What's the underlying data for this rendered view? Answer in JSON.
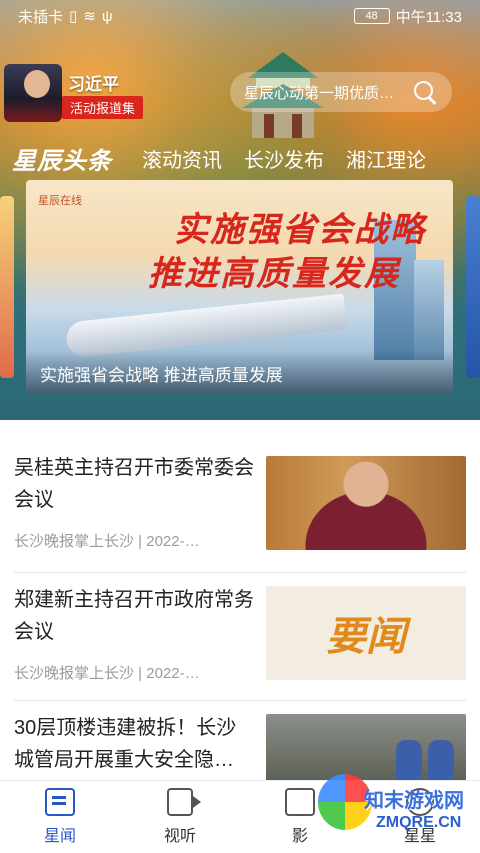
{
  "status_bar": {
    "carrier": "未插卡",
    "battery": "48",
    "time": "中午11:33"
  },
  "promo": {
    "name": "习近平",
    "subtitle": "活动报道集"
  },
  "search": {
    "placeholder": "星辰心动第一期优质…"
  },
  "tabs": [
    {
      "label": "星辰头条",
      "active": true
    },
    {
      "label": "滚动资讯"
    },
    {
      "label": "长沙发布"
    },
    {
      "label": "湘江理论"
    }
  ],
  "banner": {
    "logo": "星辰在线",
    "headline_line1": "实施强省会战略",
    "headline_line2": "推进高质量发展",
    "caption": "实施强省会战略 推进高质量发展"
  },
  "news": [
    {
      "title": "吴桂英主持召开市委常委会会议",
      "meta": "长沙晚报掌上长沙 | 2022-…"
    },
    {
      "title": "郑建新主持召开市政府常务会议",
      "meta": "长沙晚报掌上长沙 | 2022-…",
      "thumb_text": "要闻"
    },
    {
      "title": "30层顶楼违建被拆！长沙城管局开展重大安全隐…",
      "meta": ""
    }
  ],
  "bottom_nav": [
    {
      "label": "星闻",
      "icon": "news-icon",
      "active": true
    },
    {
      "label": "视听",
      "icon": "video-icon"
    },
    {
      "label": "影",
      "icon": "film-icon"
    },
    {
      "label": "星星",
      "icon": "planet-icon"
    }
  ],
  "watermark": {
    "text": "知末游戏网",
    "url": "ZMQRE.CN"
  },
  "colors": {
    "accent": "#2856c5",
    "red": "#d9261c",
    "meta_gray": "#9a9a9a"
  }
}
